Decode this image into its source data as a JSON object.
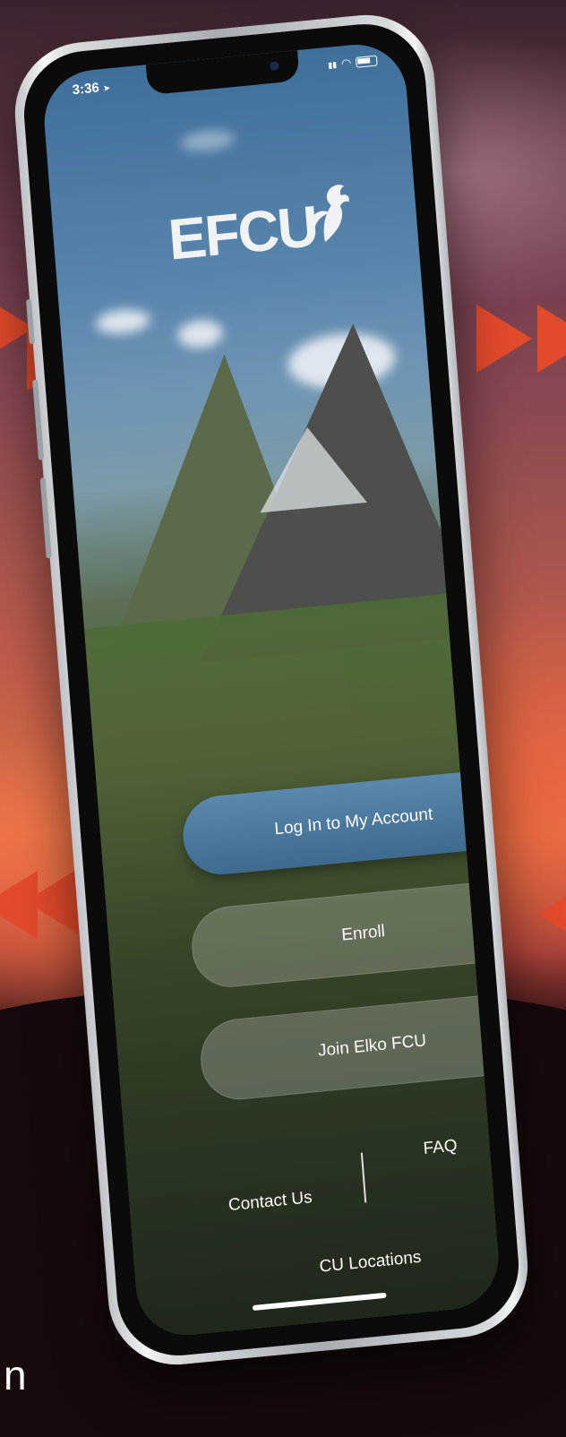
{
  "status_bar": {
    "time": "3:36",
    "location_glyph": "➤",
    "signal_glyph": "▮▮",
    "wifi_glyph": "◠"
  },
  "logo": {
    "text": "EFCU",
    "icon": "eagle-icon"
  },
  "buttons": {
    "login": "Log In to My Account",
    "enroll": "Enroll",
    "join": "Join Elko FCU"
  },
  "links": {
    "contact": "Contact Us",
    "faq": "FAQ",
    "locations": "CU Locations"
  },
  "corner_text": "n",
  "colors": {
    "primary_button": "#4a7a9f",
    "arrow_accent": "#e24a2c",
    "sky_background": "#c45f4a"
  }
}
